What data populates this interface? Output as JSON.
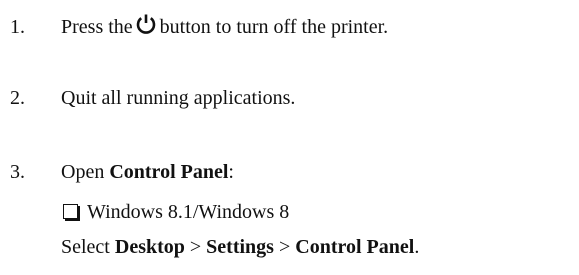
{
  "steps": [
    {
      "number": "1.",
      "text_before": "Press the",
      "icon": "power-icon",
      "text_after": "button to turn off the printer."
    },
    {
      "number": "2.",
      "text": "Quit all running applications."
    },
    {
      "number": "3.",
      "text_before": "Open",
      "bold": "Control Panel",
      "text_after": ":"
    }
  ],
  "substep": {
    "label": "Windows 8.1/Windows 8",
    "instruction": {
      "prefix": "Select",
      "item1": "Desktop",
      "sep1": ">",
      "item2": "Settings",
      "sep2": ">",
      "item3": "Control Panel",
      "suffix": "."
    }
  }
}
